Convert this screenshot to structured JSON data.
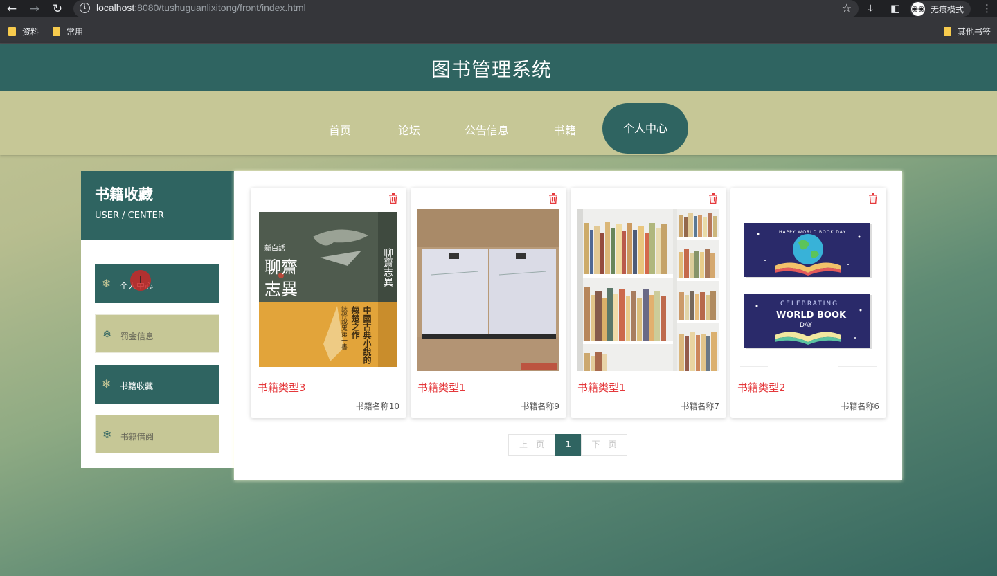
{
  "browser": {
    "url_host": "localhost",
    "url_rest": ":8080/tushuguanlixitong/front/index.html",
    "incognito_label": "无痕模式",
    "bookmarks": [
      "资料",
      "常用"
    ],
    "other_bookmarks": "其他书签"
  },
  "site": {
    "title": "图书管理系统"
  },
  "nav": {
    "items": [
      "首页",
      "论坛",
      "公告信息",
      "书籍",
      "个人中心"
    ],
    "active": "个人中心"
  },
  "sidebar": {
    "title": "书籍收藏",
    "subtitle": "USER / CENTER",
    "items": [
      "个人中心",
      "罚金信息",
      "书籍收藏",
      "书籍借阅"
    ]
  },
  "cards": [
    {
      "type": "书籍类型3",
      "name": "书籍名称10"
    },
    {
      "type": "书籍类型1",
      "name": "书籍名称9"
    },
    {
      "type": "书籍类型1",
      "name": "书籍名称7"
    },
    {
      "type": "书籍类型2",
      "name": "书籍名称6"
    }
  ],
  "cover1": {
    "t1": "新白話",
    "t2": "聊齋",
    "t3": "志異",
    "t4": "中國古典小說的",
    "t5": "翹楚之作",
    "t6": "誌怪說鬼第一書",
    "spine": "聊齋志異"
  },
  "poster": {
    "top": "HAPPY WORLD BOOK DAY",
    "bottom1": "CELEBRATING",
    "bottom2": "WORLD BOOK",
    "bottom3": "DAY"
  },
  "pagination": {
    "prev": "上一页",
    "current": "1",
    "next": "下一页"
  },
  "colors": {
    "primary": "#2f6461",
    "secondary": "#c6c796",
    "accent_red": "#e5383b"
  }
}
